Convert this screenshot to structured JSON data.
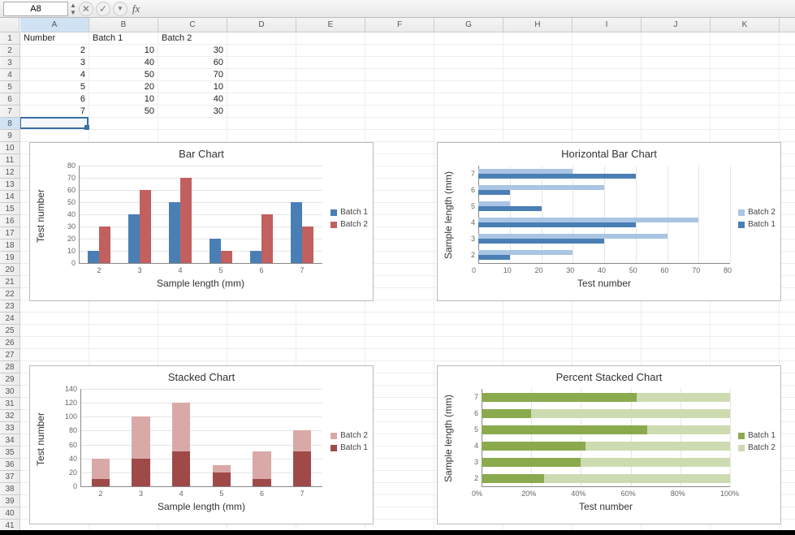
{
  "formula_bar": {
    "cell_ref": "A8",
    "fx_label": "fx",
    "formula_value": ""
  },
  "columns": [
    "A",
    "B",
    "C",
    "D",
    "E",
    "F",
    "G",
    "H",
    "I",
    "J",
    "K"
  ],
  "rows": [
    "1",
    "2",
    "3",
    "4",
    "5",
    "6",
    "7",
    "8",
    "9",
    "10",
    "11",
    "12",
    "13",
    "14",
    "15",
    "16",
    "17",
    "18",
    "19",
    "20",
    "21",
    "22",
    "23",
    "24",
    "25",
    "26",
    "27",
    "28",
    "29",
    "30",
    "31",
    "32",
    "33",
    "34",
    "35",
    "36",
    "37",
    "38",
    "39",
    "40",
    "41"
  ],
  "table": {
    "headers": [
      "Number",
      "Batch 1",
      "Batch 2"
    ],
    "data": [
      [
        "2",
        "10",
        "30"
      ],
      [
        "3",
        "40",
        "60"
      ],
      [
        "4",
        "50",
        "70"
      ],
      [
        "5",
        "20",
        "10"
      ],
      [
        "6",
        "10",
        "40"
      ],
      [
        "7",
        "50",
        "30"
      ]
    ]
  },
  "chart_data": [
    {
      "id": "bar",
      "type": "bar",
      "title": "Bar Chart",
      "xlabel": "Sample length (mm)",
      "ylabel": "Test number",
      "categories": [
        "2",
        "3",
        "4",
        "5",
        "6",
        "7"
      ],
      "series": [
        {
          "name": "Batch 1",
          "values": [
            10,
            40,
            50,
            20,
            10,
            50
          ],
          "color": "#4a7fb5"
        },
        {
          "name": "Batch 2",
          "values": [
            30,
            60,
            70,
            10,
            40,
            30
          ],
          "color": "#c1605e"
        }
      ],
      "ylim": [
        0,
        80
      ],
      "ystep": 10
    },
    {
      "id": "hbar",
      "type": "hbar",
      "title": "Horizontal Bar Chart",
      "xlabel": "Test number",
      "ylabel": "Sample length (mm)",
      "categories": [
        "2",
        "3",
        "4",
        "5",
        "6",
        "7"
      ],
      "series": [
        {
          "name": "Batch 2",
          "values": [
            30,
            60,
            70,
            10,
            40,
            30
          ],
          "color": "#a9c5e3"
        },
        {
          "name": "Batch 1",
          "values": [
            10,
            40,
            50,
            20,
            10,
            50
          ],
          "color": "#4a7fb5"
        }
      ],
      "xlim": [
        0,
        80
      ],
      "xstep": 10
    },
    {
      "id": "stacked",
      "type": "stacked-bar",
      "title": "Stacked Chart",
      "xlabel": "Sample length (mm)",
      "ylabel": "Test number",
      "categories": [
        "2",
        "3",
        "4",
        "5",
        "6",
        "7"
      ],
      "series": [
        {
          "name": "Batch 2",
          "values": [
            30,
            60,
            70,
            10,
            40,
            30
          ],
          "color": "#d9a9a8"
        },
        {
          "name": "Batch 1",
          "values": [
            10,
            40,
            50,
            20,
            10,
            50
          ],
          "color": "#9f4a48"
        }
      ],
      "ylim": [
        0,
        140
      ],
      "ystep": 20
    },
    {
      "id": "pctstacked",
      "type": "percent-stacked-hbar",
      "title": "Percent Stacked Chart",
      "xlabel": "Test number",
      "ylabel": "Sample length (mm)",
      "categories": [
        "2",
        "3",
        "4",
        "5",
        "6",
        "7"
      ],
      "series": [
        {
          "name": "Batch 1",
          "values": [
            10,
            40,
            50,
            20,
            10,
            50
          ],
          "color": "#8aaa4d"
        },
        {
          "name": "Batch 2",
          "values": [
            30,
            60,
            70,
            10,
            40,
            30
          ],
          "color": "#cddbb0"
        }
      ],
      "xticks": [
        "0%",
        "20%",
        "40%",
        "60%",
        "80%",
        "100%"
      ]
    }
  ]
}
